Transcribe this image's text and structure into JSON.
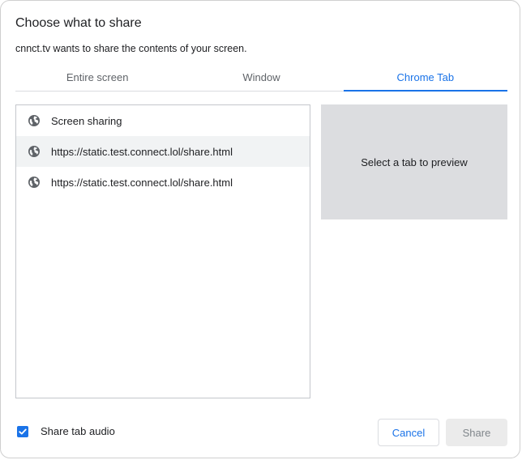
{
  "dialog": {
    "title": "Choose what to share",
    "subtitle": "cnnct.tv wants to share the contents of your screen."
  },
  "tabs": [
    {
      "label": "Entire screen",
      "active": false
    },
    {
      "label": "Window",
      "active": false
    },
    {
      "label": "Chrome Tab",
      "active": true
    }
  ],
  "tab_list": [
    {
      "label": "Screen sharing",
      "icon": "globe-icon",
      "selected": false
    },
    {
      "label": "https://static.test.connect.lol/share.html",
      "icon": "globe-icon",
      "selected": true
    },
    {
      "label": "https://static.test.connect.lol/share.html",
      "icon": "globe-icon",
      "selected": false
    }
  ],
  "preview": {
    "placeholder": "Select a tab to preview"
  },
  "audio": {
    "label": "Share tab audio",
    "checked": true
  },
  "buttons": {
    "cancel": "Cancel",
    "share": "Share"
  },
  "colors": {
    "accent": "#1a73e8",
    "preview_bg": "#dcdde0",
    "selected_row": "#f1f3f4",
    "disabled_button_bg": "#ebebeb"
  }
}
